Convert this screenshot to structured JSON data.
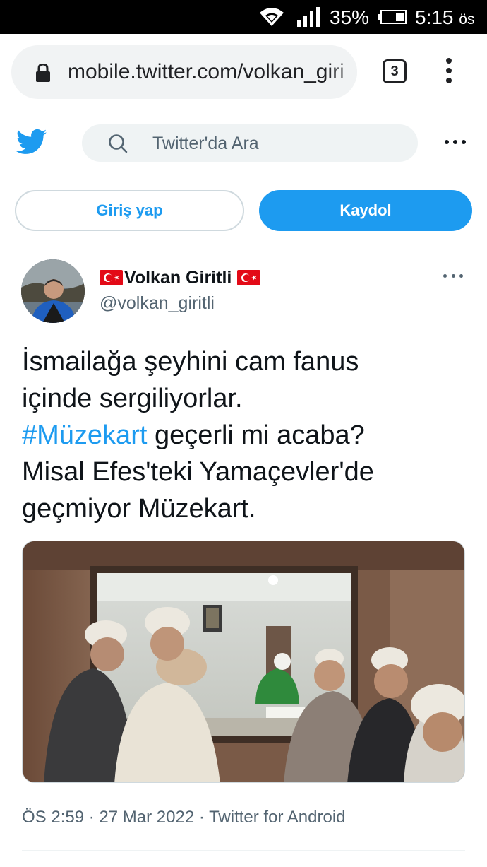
{
  "status_bar": {
    "battery_percent": "35%",
    "time": "5:15",
    "ampm": "ös"
  },
  "browser": {
    "url": "mobile.twitter.com/volkan_giritli",
    "tab_count": "3"
  },
  "header": {
    "search_placeholder": "Twitter'da Ara"
  },
  "auth": {
    "login_label": "Giriş yap",
    "signup_label": "Kaydol"
  },
  "tweet": {
    "author_name": "Volkan Giritli",
    "author_handle": "@volkan_giritli",
    "text_line1": "İsmailağa şeyhini cam fanus",
    "text_line2": "içinde sergiliyorlar.",
    "hashtag": "#Müzekart",
    "text_line3_rest": " geçerli mi acaba?",
    "text_line4": "Misal Efes'teki Yamaçevler'de",
    "text_line5": "geçmiyor Müzekart.",
    "time": "ÖS 2:59",
    "date": "27 Mar 2022",
    "source": "Twitter for Android",
    "separator": "·"
  },
  "colors": {
    "twitter_blue": "#1d9bf0",
    "text_primary": "#0f1419",
    "text_secondary": "#536471",
    "flag_red": "#e30a17"
  }
}
